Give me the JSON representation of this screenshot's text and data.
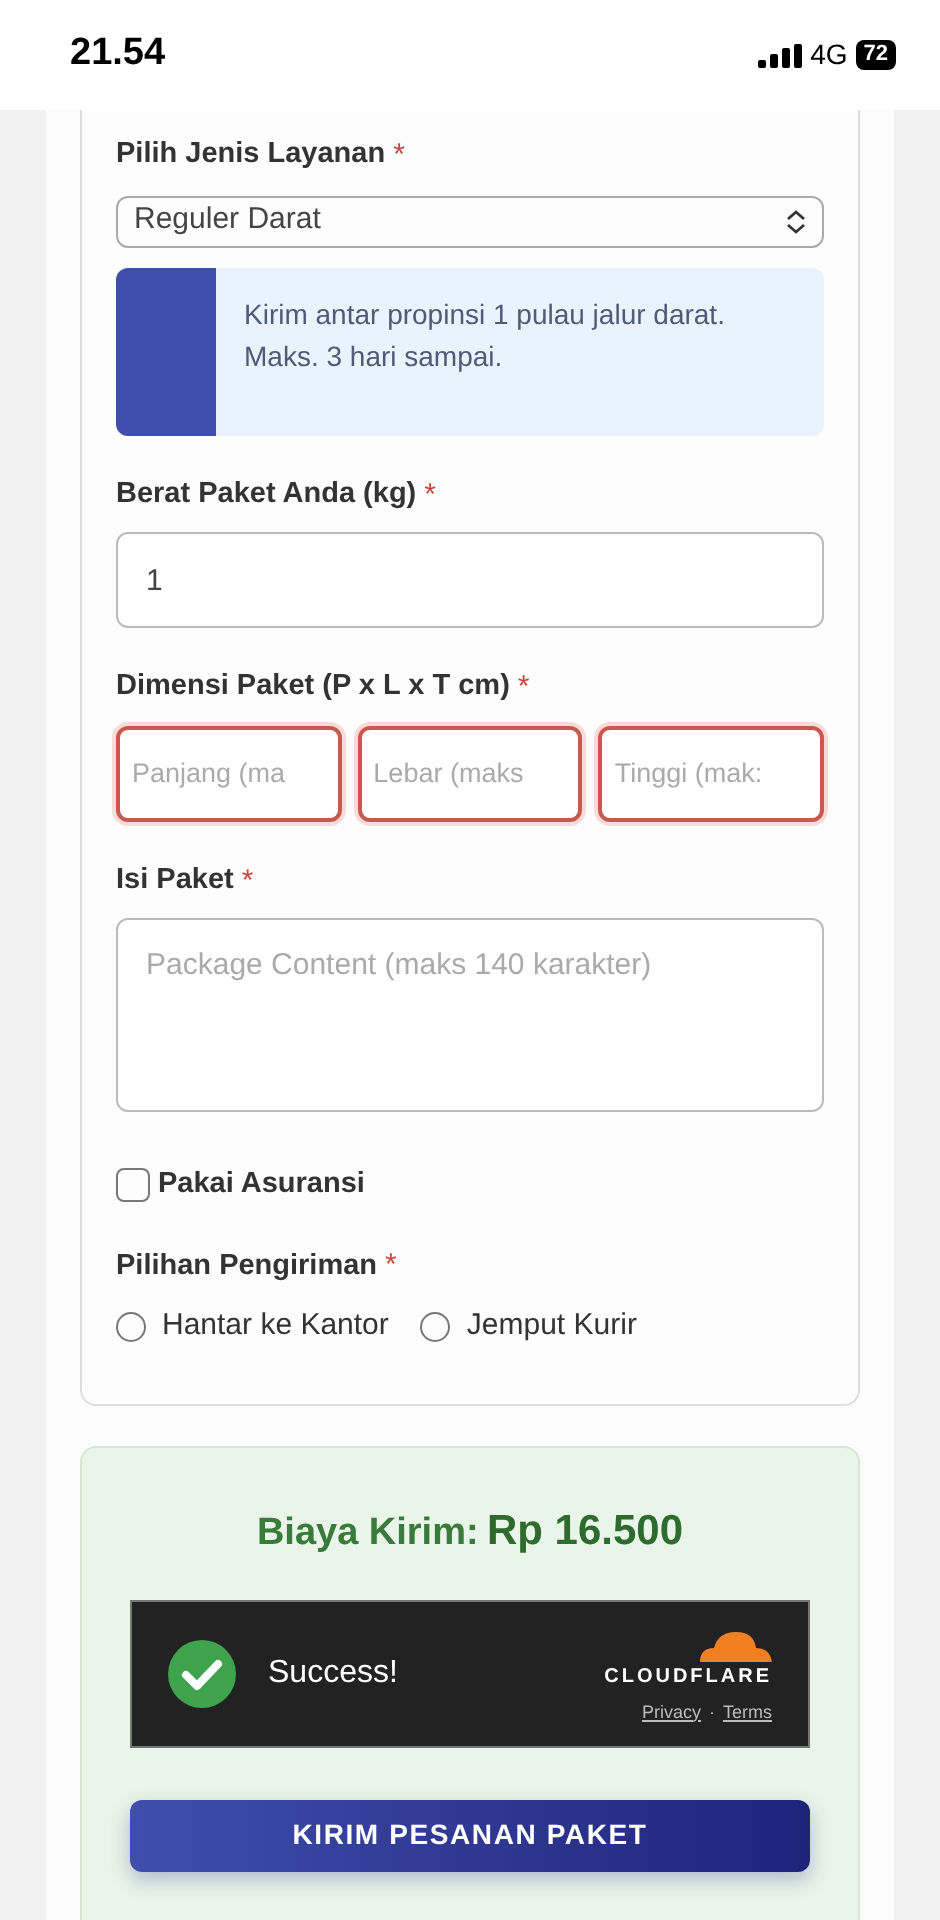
{
  "status_bar": {
    "time": "21.54",
    "network": "4G",
    "battery": "72"
  },
  "service": {
    "label": "Pilih Jenis Layanan",
    "required_mark": "*",
    "value": "Reguler Darat",
    "info": "Kirim antar propinsi 1 pulau jalur darat. Maks. 3 hari sampai."
  },
  "weight": {
    "label": "Berat Paket Anda (kg)",
    "required_mark": "*",
    "value": "1"
  },
  "dimensions": {
    "label": "Dimensi Paket (P x L x T cm)",
    "required_mark": "*",
    "fields": [
      {
        "placeholder": "Panjang (ma",
        "invalid": true
      },
      {
        "placeholder": "Lebar (maks",
        "invalid": true
      },
      {
        "placeholder": "Tinggi (mak:",
        "invalid": true
      }
    ]
  },
  "content": {
    "label": "Isi Paket",
    "required_mark": "*",
    "placeholder": "Package Content (maks 140 karakter)"
  },
  "insurance": {
    "label": "Pakai Asuransi",
    "checked": false
  },
  "delivery": {
    "label": "Pilihan Pengiriman",
    "required_mark": "*",
    "options": [
      {
        "label": "Hantar ke Kantor",
        "selected": false
      },
      {
        "label": "Jemput Kurir",
        "selected": false
      }
    ]
  },
  "cost": {
    "label": "Biaya Kirim:",
    "amount": "Rp 16.500"
  },
  "captcha": {
    "status": "Success!",
    "brand": "CLOUDFLARE",
    "links": [
      "Privacy",
      "Terms"
    ],
    "separator": "·"
  },
  "submit": "KIRIM PESANAN PAKET"
}
